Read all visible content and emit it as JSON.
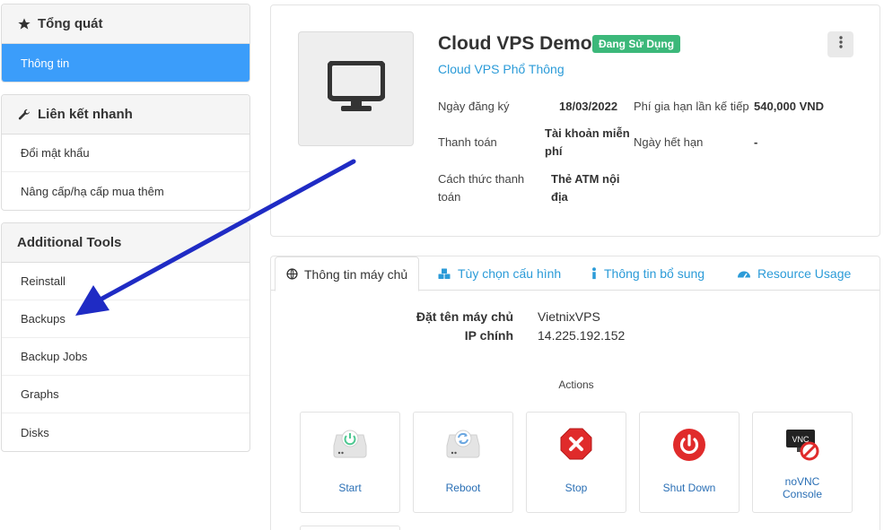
{
  "sidebar": {
    "overview": {
      "title": "Tổng quát",
      "items": [
        "Thông tin"
      ]
    },
    "quicklinks": {
      "title": "Liên kết nhanh",
      "items": [
        "Đổi mật khẩu",
        "Nâng cấp/hạ cấp mua thêm"
      ]
    },
    "tools": {
      "title": "Additional Tools",
      "items": [
        "Reinstall",
        "Backups",
        "Backup Jobs",
        "Graphs",
        "Disks"
      ]
    }
  },
  "product": {
    "title": "Cloud VPS Demo",
    "status": "Đang Sử Dụng",
    "subtitle": "Cloud VPS Phổ Thông",
    "reg_label": "Ngày đăng ký",
    "reg_value": "18/03/2022",
    "renew_label": "Phí gia hạn lần kế tiếp",
    "renew_value": "540,000 VND",
    "pay_label": "Thanh toán",
    "pay_value_1": "Tài khoản miễn",
    "pay_value_2": "phí",
    "due_label": "Ngày hết hạn",
    "due_value": "-",
    "method_label_1": "Cách thức thanh",
    "method_label_2": "toán",
    "method_value_1": "Thẻ ATM nội",
    "method_value_2": "địa"
  },
  "tabs": [
    "Thông tin máy chủ",
    "Tùy chọn cấu hình",
    "Thông tin bổ sung",
    "Resource Usage"
  ],
  "server": {
    "hostname_label": "Đặt tên máy chủ",
    "hostname_value": "VietnixVPS",
    "ip_label": "IP chính",
    "ip_value": "14.225.192.152"
  },
  "actions": {
    "title": "Actions",
    "start": "Start",
    "reboot": "Reboot",
    "stop": "Stop",
    "shutdown": "Shut Down",
    "novnc_1": "noVNC",
    "novnc_2": "Console",
    "vnc_badge": "VNC"
  },
  "colors": {
    "active_item": "#3b9dfa",
    "link": "#2b9bd8",
    "status_badge": "#3cb87a",
    "annotation_arrow": "#1f2bc4"
  }
}
